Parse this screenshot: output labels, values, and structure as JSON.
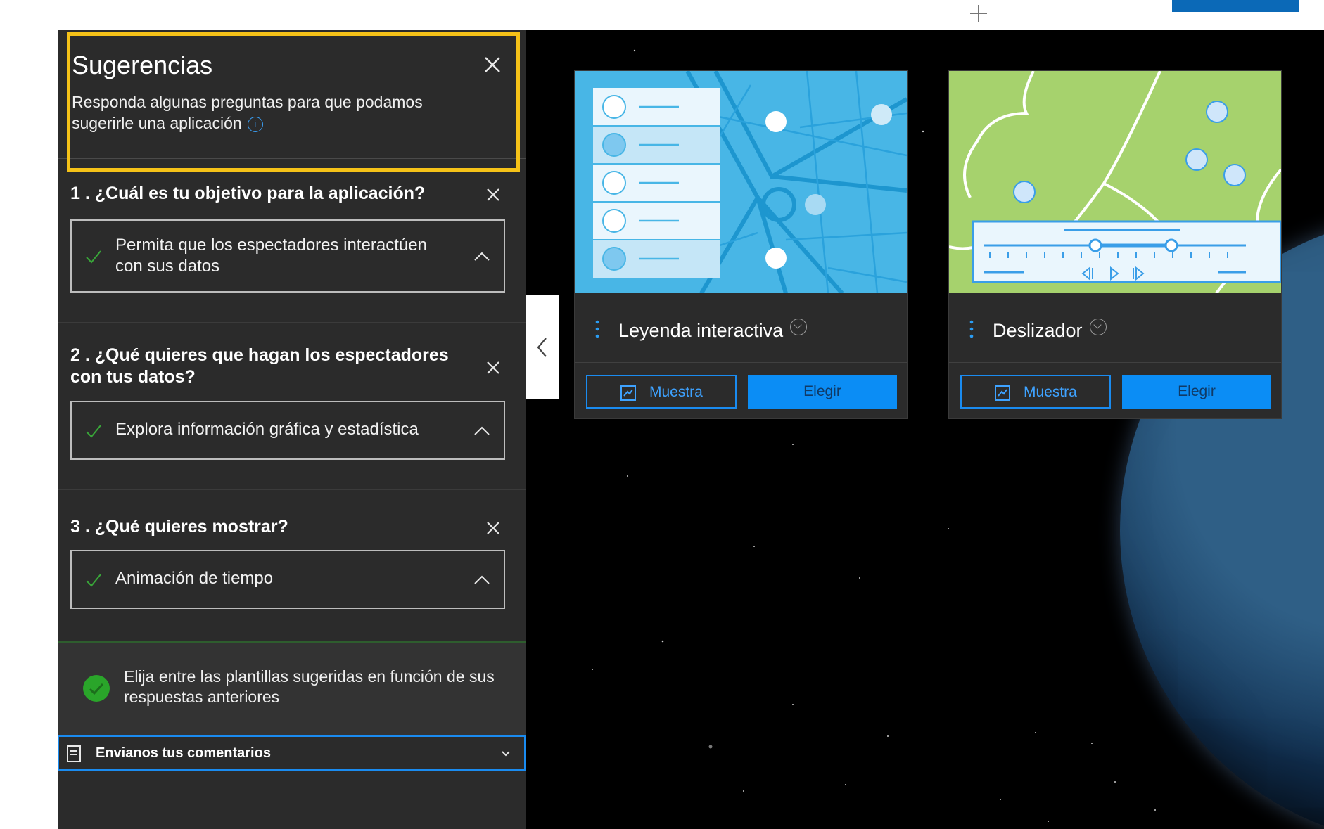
{
  "panel": {
    "title": "Sugerencias",
    "subtitle": "Responda algunas preguntas para que podamos sugerirle una aplicación",
    "info_icon": "info-icon",
    "close_icon": "close-icon"
  },
  "questions": [
    {
      "title": "1 . ¿Cuál es tu objetivo para la aplicación?",
      "answer": "Permita que los espectadores interactúen con sus datos"
    },
    {
      "title": "2 . ¿Qué quieres que hagan los espectadores con tus datos?",
      "answer": "Explora información gráfica y estadística"
    },
    {
      "title": "3 . ¿Qué quieres mostrar?",
      "answer": "Animación de tiempo"
    }
  ],
  "suggestion": {
    "text": "Elija entre las plantillas sugeridas en función de sus respuestas anteriores",
    "icon": "check-circle-icon"
  },
  "feedback": {
    "label": "Envianos tus comentarios",
    "icon": "feedback-icon"
  },
  "cards": [
    {
      "title": "Leyenda interactiva",
      "sample_label": "Muestra",
      "choose_label": "Elegir",
      "thumb_color": "#48b6e6"
    },
    {
      "title": "Deslizador",
      "sample_label": "Muestra",
      "choose_label": "Elegir",
      "thumb_color": "#a6d26d"
    }
  ],
  "colors": {
    "accent": "#0b8df5",
    "highlight": "#f5c218",
    "panel_bg": "#2b2b2b",
    "check": "#2aa52a"
  }
}
